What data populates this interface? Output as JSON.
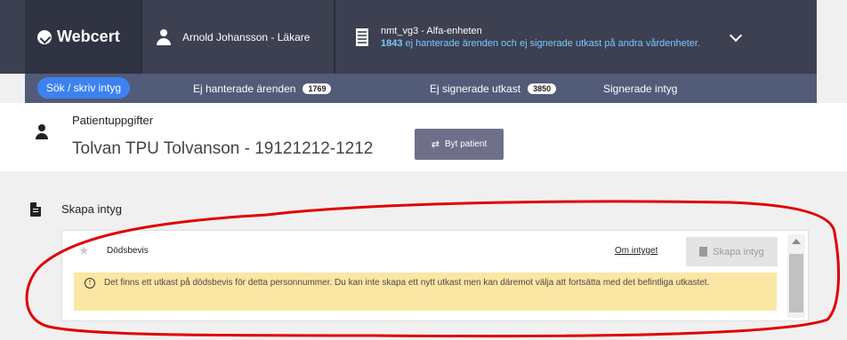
{
  "header": {
    "brand": "Webcert",
    "user": "Arnold Johansson - Läkare",
    "unit_name": "nmt_vg3 - Alfa-enheten",
    "unit_count": "1843",
    "unit_notice": " ej hanterade ärenden och ej signerade utkast på andra vårdenheter."
  },
  "nav": {
    "tabs": [
      {
        "label": "Sök / skriv intyg"
      },
      {
        "label": "Ej hanterade ärenden",
        "badge": "1769"
      },
      {
        "label": "Ej signerade utkast",
        "badge": "3850"
      },
      {
        "label": "Signerade intyg"
      }
    ]
  },
  "patient": {
    "label": "Patientuppgifter",
    "name": "Tolvan TPU Tolvanson - 19121212-1212",
    "switch_label": "Byt patient"
  },
  "create": {
    "title": "Skapa intyg",
    "item_title": "Dödsbevis",
    "about_link": "Om intyget",
    "create_button": "Skapa intyg",
    "warning": "Det finns ett utkast på dödsbevis för detta personnummer. Du kan inte skapa ett nytt utkast men kan däremot välja att fortsätta med det befintliga utkastet."
  },
  "colors": {
    "topbar": "#3c4051",
    "navbar": "#525b78",
    "active_tab": "#3d82f0",
    "warning_bg": "#fbe6a4",
    "annotation": "#e00000"
  }
}
